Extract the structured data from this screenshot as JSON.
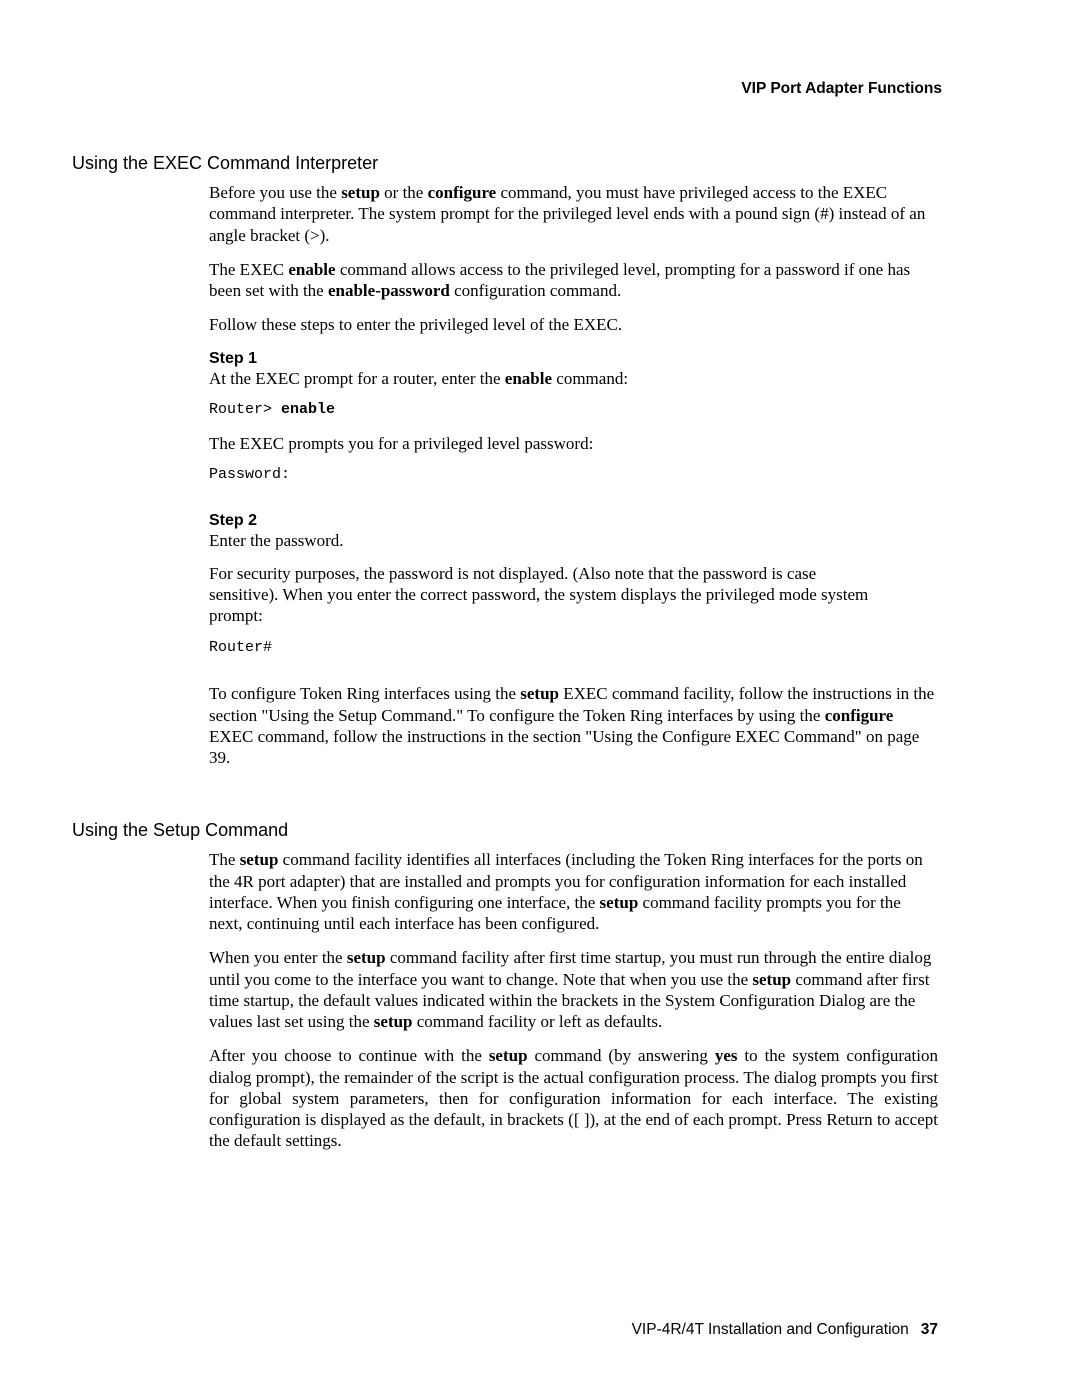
{
  "header": {
    "right": "VIP Port Adapter Functions"
  },
  "section1": {
    "heading": "Using the EXEC Command Interpreter",
    "p1_a": "Before you use the ",
    "p1_b1": "setup",
    "p1_b": " or the ",
    "p1_b2": "configure",
    "p1_c": " command, you must have privileged access to the EXEC command interpreter. The system prompt for the privileged level ends with a pound sign (#) instead of an angle bracket (>).",
    "p2_a": "The EXEC ",
    "p2_b1": "enable",
    "p2_b": " command allows access to the privileged level, prompting for a password if one has been set with the ",
    "p2_b2": "enable-password",
    "p2_c": " configuration command.",
    "p3": "Follow these steps to enter the privileged level of the EXEC.",
    "step1_label": "Step 1",
    "step1_line1_a": "At the EXEC prompt for a router, enter the ",
    "step1_line1_b": "enable",
    "step1_line1_c": " command:",
    "step1_term_prefix": "Router> ",
    "step1_term_cmd": "enable",
    "step1_line2": "The EXEC prompts you for a privileged level password:",
    "step1_term2": "Password:",
    "step2_label": "Step 2",
    "step2_line1": "Enter the password.",
    "step2_line2": "For security purposes, the password is not displayed. (Also note that the password is case sensitive). When you enter the correct password, the system displays the privileged mode system prompt:",
    "step2_term": "Router#",
    "p4_a": "To configure Token Ring interfaces using the ",
    "p4_b1": "setup",
    "p4_b": " EXEC command facility, follow the instructions in the section \"Using the Setup Command.\" To configure the Token Ring interfaces by using the ",
    "p4_b2": "configure",
    "p4_c": " EXEC command, follow the instructions in the section \"Using the Configure EXEC Command\" on page 39."
  },
  "section2": {
    "heading": "Using the Setup Command",
    "p1_a": "The ",
    "p1_b1": "setup",
    "p1_b": " command facility identifies all interfaces (including the Token Ring interfaces for the ports on the 4R port adapter) that are installed and prompts you for configuration information for each installed interface. When you finish configuring one interface, the ",
    "p1_b2": "setup",
    "p1_c": " command facility prompts you for the next, continuing until each interface has been configured.",
    "p2_a": "When you enter the ",
    "p2_b1": "setup",
    "p2_b": " command facility after first time startup, you must run through the entire dialog until you come to the interface you want to change. Note that when you use the ",
    "p2_b2": "setup",
    "p2_c": " command after first time startup, the default values indicated within the brackets in the System Configuration Dialog are the values last set using the ",
    "p2_b3": "setup",
    "p2_d": " command facility or left as defaults.",
    "p3_a": "After you choose to continue with the ",
    "p3_b1": "setup",
    "p3_b": " command (by answering ",
    "p3_b2": "yes",
    "p3_c": " to the system configuration dialog prompt), the remainder of the script is the actual configuration process. The dialog prompts you first for global system parameters, then for configuration information for each interface. The existing configuration is displayed as the default, in brackets ([ ]), at the end of each prompt. Press Return to accept the default settings."
  },
  "footer": {
    "title": "VIP-4R/4T Installation and Configuration",
    "page": "37"
  }
}
